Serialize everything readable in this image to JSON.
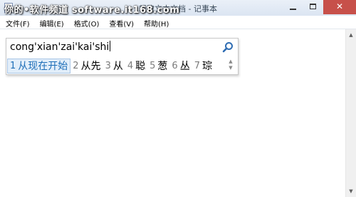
{
  "window": {
    "title": "新建文本文档 - 记事本",
    "watermark": "你的•软件频道 software.it168.com",
    "close_glyph": "✕"
  },
  "menu": {
    "items": [
      {
        "label": "文件(F)"
      },
      {
        "label": "编辑(E)"
      },
      {
        "label": "格式(O)"
      },
      {
        "label": "查看(V)"
      },
      {
        "label": "帮助(H)"
      }
    ]
  },
  "ime": {
    "input": "cong'xian'zai'kai'shi",
    "search_icon": "search-icon",
    "candidates": [
      {
        "num": "1",
        "text": "从现在开始",
        "selected": true
      },
      {
        "num": "2",
        "text": "从先"
      },
      {
        "num": "3",
        "text": "从"
      },
      {
        "num": "4",
        "text": "聪"
      },
      {
        "num": "5",
        "text": "葱"
      },
      {
        "num": "6",
        "text": "丛"
      },
      {
        "num": "7",
        "text": "琮"
      }
    ],
    "page_up": "▲",
    "page_down": "▼"
  },
  "scrollbar": {
    "up": "▲",
    "down": "▼"
  },
  "colors": {
    "close_button": "#c7504a",
    "selected_candidate": "#1f6fb8",
    "selected_bg": "#e2eefa"
  }
}
